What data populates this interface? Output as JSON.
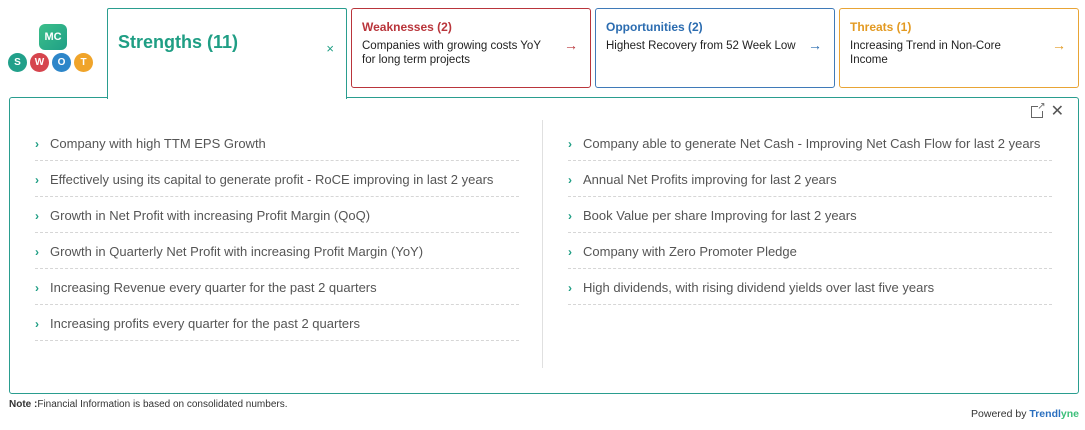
{
  "logo": {
    "mc_text": "MC",
    "letters": [
      "S",
      "W",
      "O",
      "T"
    ],
    "colors": {
      "s": "#21a08a",
      "w": "#d6444d",
      "o": "#2d86c9",
      "t": "#f0a42a"
    }
  },
  "tabs": {
    "strengths": {
      "title": "Strengths (11)",
      "close": "×",
      "color": "#1f9e84"
    },
    "weaknesses": {
      "title": "Weaknesses (2)",
      "text": "Companies with growing costs YoY for long term projects",
      "arrow": "→",
      "color": "#b9353b"
    },
    "opportunities": {
      "title": "Opportunities (2)",
      "text": "Highest Recovery from 52 Week Low",
      "arrow": "→",
      "color": "#2b6cb0"
    },
    "threats": {
      "title": "Threats (1)",
      "text": "Increasing Trend in Non-Core Income",
      "arrow": "→",
      "color": "#e39a22"
    }
  },
  "panel": {
    "expand_icon": "external-link-icon",
    "close": "✕",
    "left_items": [
      {
        "chev": "›",
        "text": "Company with high TTM EPS Growth"
      },
      {
        "chev": "›",
        "text": "Effectively using its capital to generate profit - RoCE improving in last 2 years"
      },
      {
        "chev": "›",
        "text": "Growth in Net Profit with increasing Profit Margin (QoQ)"
      },
      {
        "chev": "›",
        "text": "Growth in Quarterly Net Profit with increasing Profit Margin (YoY)"
      },
      {
        "chev": "›",
        "text": "Increasing Revenue every quarter for the past 2 quarters"
      },
      {
        "chev": "›",
        "text": "Increasing profits every quarter for the past 2 quarters"
      }
    ],
    "right_items": [
      {
        "chev": "›",
        "text": "Company able to generate Net Cash - Improving Net Cash Flow for last 2 years"
      },
      {
        "chev": "›",
        "text": "Annual Net Profits improving for last 2 years"
      },
      {
        "chev": "›",
        "text": "Book Value per share Improving for last 2 years"
      },
      {
        "chev": "›",
        "text": "Company with Zero Promoter Pledge"
      },
      {
        "chev": "›",
        "text": "High dividends, with rising dividend yields over last five years"
      }
    ]
  },
  "footer": {
    "note_label": "Note :",
    "note_text": "Financial Information is based on consolidated numbers.",
    "powered_by": "Powered by ",
    "brand_main": "Trendl",
    "brand_end": "yne"
  }
}
